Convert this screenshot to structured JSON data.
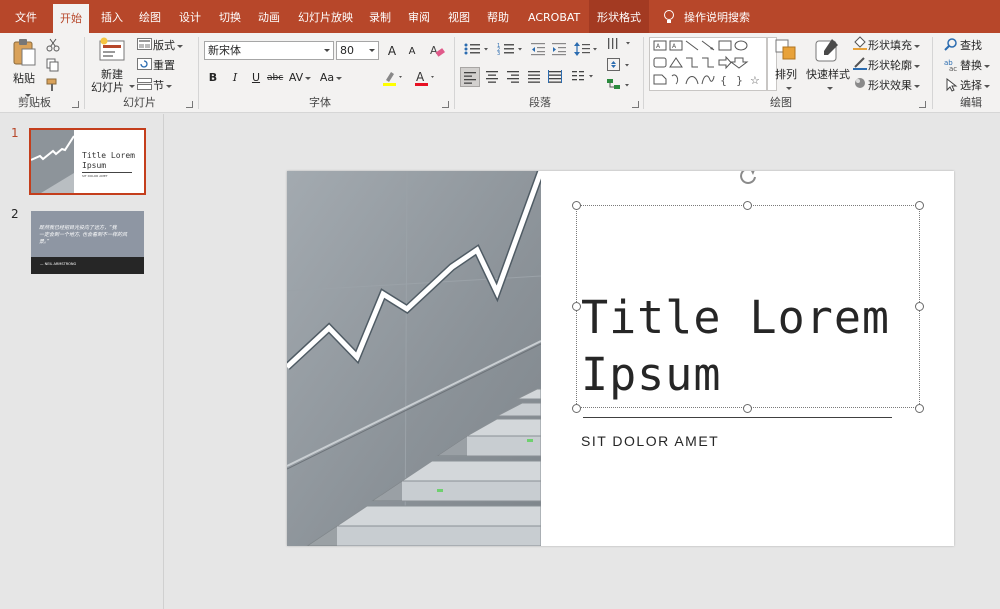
{
  "tabs": [
    {
      "label": "文件"
    },
    {
      "label": "开始"
    },
    {
      "label": "插入"
    },
    {
      "label": "绘图"
    },
    {
      "label": "设计"
    },
    {
      "label": "切换"
    },
    {
      "label": "动画"
    },
    {
      "label": "幻灯片放映"
    },
    {
      "label": "录制"
    },
    {
      "label": "审阅"
    },
    {
      "label": "视图"
    },
    {
      "label": "帮助"
    },
    {
      "label": "ACROBAT"
    },
    {
      "label": "形状格式"
    }
  ],
  "tell_me": "操作说明搜索",
  "clipboard": {
    "paste": "粘贴",
    "group": "剪贴板"
  },
  "slides_group": {
    "new_line1": "新建",
    "new_line2": "幻灯片",
    "layout": "版式",
    "reset": "重置",
    "section": "节",
    "group": "幻灯片"
  },
  "font": {
    "name": "新宋体",
    "size": "80",
    "group": "字体",
    "bold": "B",
    "italic": "I",
    "underline": "U",
    "strike": "abc",
    "spacing": "AV",
    "case": "Aa",
    "grow": "A",
    "shrink": "A"
  },
  "paragraph": {
    "group": "段落"
  },
  "drawing": {
    "arrange": "排列",
    "quick_styles": "快速样式",
    "fill": "形状填充",
    "outline": "形状轮廓",
    "effects": "形状效果",
    "group": "绘图"
  },
  "editing": {
    "find": "查找",
    "replace": "替换",
    "select": "选择",
    "group": "编辑"
  },
  "thumbnails": [
    {
      "number": "1",
      "title_line1": "Title Lorem",
      "title_line2": "Ipsum",
      "subtitle": "SIT DOLOR AMET"
    },
    {
      "number": "2",
      "quote_line1": "既然我已经把目光投向了远方，“我",
      "quote_line2": "一定会到一个地方, 也会看到不一样的风",
      "quote_line3": "景。”",
      "footer": "— NEIL ARMSTRONG"
    }
  ],
  "slide": {
    "title_line1": "Title Lorem",
    "title_line2": "Ipsum",
    "subtitle": "SIT DOLOR AMET"
  },
  "colors": {
    "accent": "#b7472a",
    "ribbon": "#f3f2f1",
    "workspace": "#e6e6e6"
  }
}
